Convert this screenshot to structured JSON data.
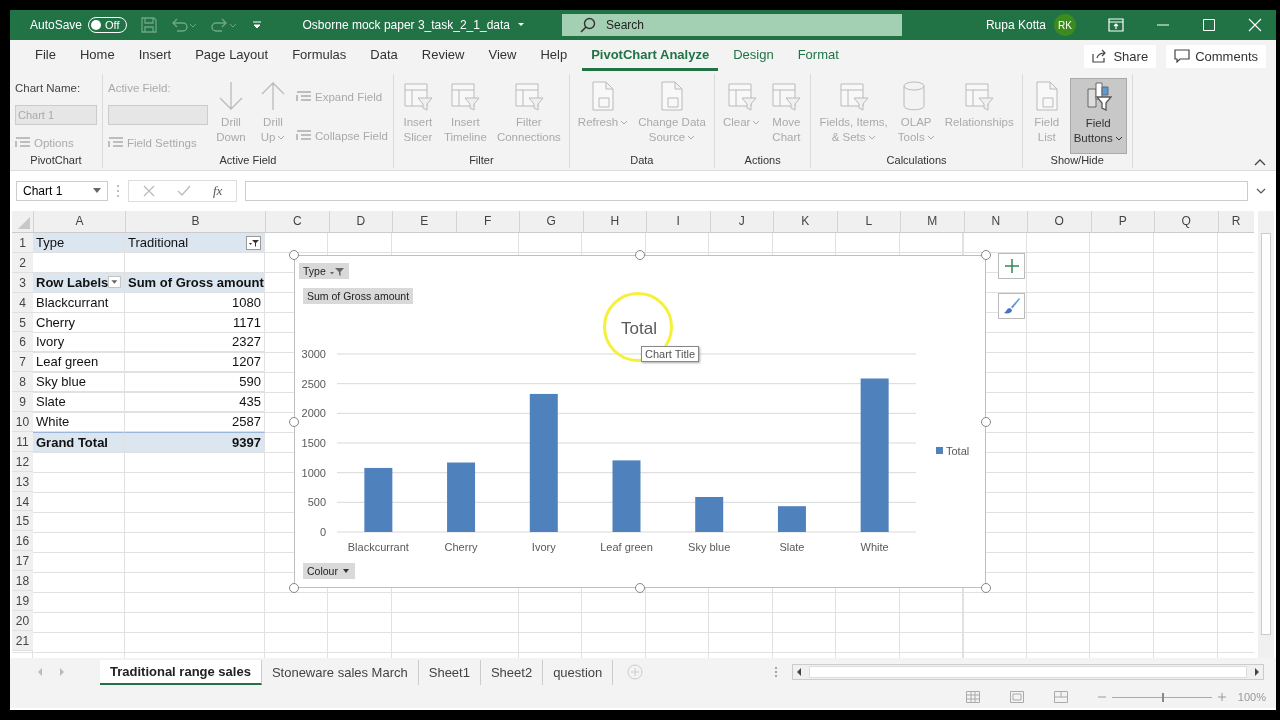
{
  "title_bar": {
    "autosave_label": "AutoSave",
    "autosave_toggle": {
      "label": "Off",
      "on": false
    },
    "document_title": "Osborne mock paper 3_task_2_1_data",
    "search": {
      "placeholder": "Search"
    },
    "user_name": "Rupa Kotta",
    "avatar_initials": "RK"
  },
  "ribbon_tabs": [
    {
      "label": "File",
      "selected": false,
      "contextual": false
    },
    {
      "label": "Home",
      "selected": false,
      "contextual": false
    },
    {
      "label": "Insert",
      "selected": false,
      "contextual": false
    },
    {
      "label": "Page Layout",
      "selected": false,
      "contextual": false
    },
    {
      "label": "Formulas",
      "selected": false,
      "contextual": false
    },
    {
      "label": "Data",
      "selected": false,
      "contextual": false
    },
    {
      "label": "Review",
      "selected": false,
      "contextual": false
    },
    {
      "label": "View",
      "selected": false,
      "contextual": false
    },
    {
      "label": "Help",
      "selected": false,
      "contextual": false
    },
    {
      "label": "PivotChart Analyze",
      "selected": true,
      "contextual": true
    },
    {
      "label": "Design",
      "selected": false,
      "contextual": true
    },
    {
      "label": "Format",
      "selected": false,
      "contextual": true
    }
  ],
  "share_button": "Share",
  "comments_button": "Comments",
  "ribbon_groups": [
    {
      "name": "PivotChart",
      "items": [
        {
          "kind": "stack",
          "items": [
            {
              "kind": "label",
              "label": "Chart Name:",
              "disabled": false
            },
            {
              "kind": "field",
              "value": "Chart 1",
              "disabled": true
            },
            {
              "kind": "small",
              "label": "Options",
              "disabled": true
            }
          ]
        }
      ]
    },
    {
      "name": "Active Field",
      "items": [
        {
          "kind": "stack",
          "items": [
            {
              "kind": "label",
              "label": "Active Field:",
              "disabled": true
            },
            {
              "kind": "field",
              "disabled": true
            },
            {
              "kind": "small",
              "label": "Field Settings",
              "disabled": true
            }
          ]
        },
        {
          "kind": "large",
          "lines": [
            "Drill",
            "Down"
          ],
          "dropdown": false,
          "disabled": true,
          "on": false
        },
        {
          "kind": "large",
          "lines": [
            "Drill",
            "Up"
          ],
          "dropdown": true,
          "disabled": true,
          "on": false
        },
        {
          "kind": "stack",
          "items": [
            {
              "kind": "small",
              "label": "Expand Field",
              "disabled": true
            },
            {
              "kind": "small",
              "label": "Collapse Field",
              "disabled": true
            }
          ]
        }
      ]
    },
    {
      "name": "Filter",
      "items": [
        {
          "kind": "large",
          "lines": [
            "Insert",
            "Slicer"
          ],
          "dropdown": false,
          "disabled": true,
          "on": false
        },
        {
          "kind": "large",
          "lines": [
            "Insert",
            "Timeline"
          ],
          "dropdown": false,
          "disabled": true,
          "on": false
        },
        {
          "kind": "large",
          "lines": [
            "Filter",
            "Connections"
          ],
          "dropdown": false,
          "disabled": true,
          "on": false
        }
      ]
    },
    {
      "name": "Data",
      "items": [
        {
          "kind": "large",
          "lines": [
            "Refresh"
          ],
          "dropdown": true,
          "disabled": true,
          "on": false
        },
        {
          "kind": "large",
          "lines": [
            "Change Data",
            "Source"
          ],
          "dropdown": true,
          "disabled": true,
          "on": false
        }
      ]
    },
    {
      "name": "Actions",
      "items": [
        {
          "kind": "large",
          "lines": [
            "Clear"
          ],
          "dropdown": true,
          "disabled": true,
          "on": false
        },
        {
          "kind": "large",
          "lines": [
            "Move",
            "Chart"
          ],
          "dropdown": false,
          "disabled": true,
          "on": false
        }
      ]
    },
    {
      "name": "Calculations",
      "items": [
        {
          "kind": "large",
          "lines": [
            "Fields, Items,",
            "& Sets"
          ],
          "dropdown": true,
          "disabled": true,
          "on": false
        },
        {
          "kind": "large",
          "lines": [
            "OLAP",
            "Tools"
          ],
          "dropdown": true,
          "disabled": true,
          "on": false
        },
        {
          "kind": "large",
          "lines": [
            "Relationships"
          ],
          "dropdown": false,
          "disabled": true,
          "on": false
        }
      ]
    },
    {
      "name": "Show/Hide",
      "items": [
        {
          "kind": "large",
          "lines": [
            "Field",
            "List"
          ],
          "dropdown": false,
          "disabled": true,
          "on": false
        },
        {
          "kind": "large",
          "lines": [
            "Field",
            "Buttons"
          ],
          "dropdown": true,
          "disabled": false,
          "on": true
        }
      ]
    }
  ],
  "name_box": "Chart 1",
  "formula_label": "fx",
  "columns": [
    "A",
    "B",
    "C",
    "D",
    "E",
    "F",
    "G",
    "H",
    "I",
    "J",
    "K",
    "L",
    "M",
    "N",
    "O",
    "P",
    "Q",
    "R"
  ],
  "row_numbers": [
    "1",
    "2",
    "3",
    "4",
    "5",
    "6",
    "7",
    "8",
    "9",
    "10",
    "11",
    "12",
    "13",
    "14",
    "15",
    "16",
    "17",
    "18",
    "19",
    "20",
    "21"
  ],
  "pivot": {
    "filter": {
      "label": "Type",
      "value": "Traditional"
    },
    "header": {
      "row_labels": "Row Labels",
      "value_header": "Sum of Gross amount"
    },
    "rows": [
      {
        "label": "Blackcurrant",
        "value": "1080"
      },
      {
        "label": "Cherry",
        "value": "1171"
      },
      {
        "label": "Ivory",
        "value": "2327"
      },
      {
        "label": "Leaf green",
        "value": "1207"
      },
      {
        "label": "Sky blue",
        "value": "590"
      },
      {
        "label": "Slate",
        "value": "435"
      },
      {
        "label": "White",
        "value": "2587"
      }
    ],
    "grand_total": {
      "label": "Grand Total",
      "value": "9397"
    }
  },
  "chart": {
    "field_buttons": {
      "filter": "Type",
      "values": "Sum of Gross amount",
      "axis": "Colour"
    },
    "tooltip": "Chart Title",
    "chart_data": {
      "type": "bar",
      "title": "Total",
      "categories": [
        "Blackcurrant",
        "Cherry",
        "Ivory",
        "Leaf green",
        "Sky blue",
        "Slate",
        "White"
      ],
      "series": [
        {
          "name": "Total",
          "color": "#4f81bd",
          "values": [
            1080,
            1171,
            2327,
            1207,
            590,
            435,
            2587
          ]
        }
      ],
      "ylim": [
        0,
        3000
      ],
      "grid": true,
      "yticks": [
        0,
        500,
        1000,
        1500,
        2000,
        2500,
        3000
      ]
    }
  },
  "sheet_tabs": [
    {
      "label": "Traditional range sales",
      "selected": true
    },
    {
      "label": "Stoneware sales March",
      "selected": false
    },
    {
      "label": "Sheet1",
      "selected": false
    },
    {
      "label": "Sheet2",
      "selected": false
    },
    {
      "label": "question",
      "selected": false
    }
  ],
  "status_bar": {
    "zoom_slider": {
      "level": 0.5
    },
    "zoom": "100%"
  }
}
